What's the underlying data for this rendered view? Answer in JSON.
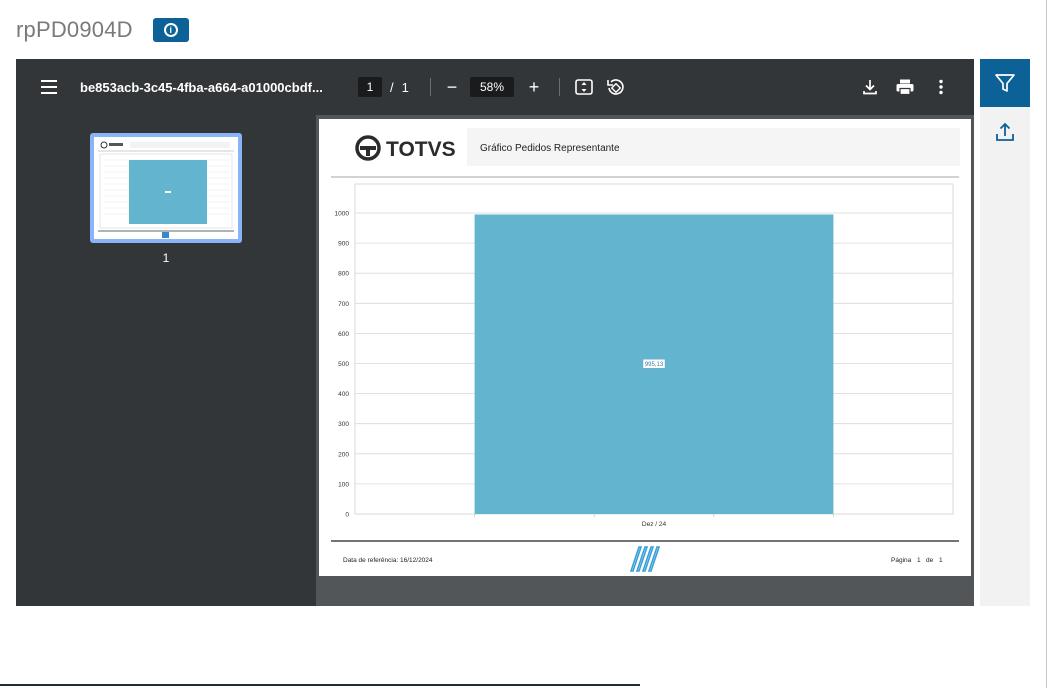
{
  "page": {
    "title": "rpPD0904D",
    "info_icon": "info-circle-icon"
  },
  "viewer": {
    "menu_icon": "hamburger-icon",
    "document_name": "be853acb-3c45-4fba-a664-a01000cbdf...",
    "current_page": "1",
    "page_separator": "/",
    "total_pages": "1",
    "zoom_minus_label": "−",
    "zoom_level": "58%",
    "zoom_plus_label": "+",
    "icons": [
      "fit-page-icon",
      "rotate-icon",
      "download-icon",
      "print-icon",
      "more-vertical-icon"
    ],
    "thumbnail_label": "1"
  },
  "report": {
    "logo_text": "TOTVS",
    "report_title": "Gráfico Pedidos Representante",
    "footer_ref_label": "Data de referência:",
    "footer_ref_date": "16/12/2024",
    "footer_page_label": "Página",
    "footer_page_num": "1",
    "footer_page_of": "de",
    "footer_page_total": "1"
  },
  "chart_data": {
    "type": "bar",
    "categories": [
      "Dez / 24"
    ],
    "values": [
      995.13
    ],
    "data_labels": [
      "995,13"
    ],
    "ylim": [
      0,
      1000
    ],
    "yticks": [
      0,
      100,
      200,
      300,
      400,
      500,
      600,
      700,
      800,
      900,
      1000
    ],
    "grid": true,
    "bar_color": "#63b4cf",
    "title": "",
    "xlabel": "",
    "ylabel": ""
  },
  "right_rail": {
    "filter_icon": "filter-icon",
    "upload_icon": "upload-icon"
  },
  "colors": {
    "accent": "#0c6196",
    "toolbar_bg": "#323639",
    "viewer_bg": "#525659",
    "bar": "#63b4cf"
  }
}
